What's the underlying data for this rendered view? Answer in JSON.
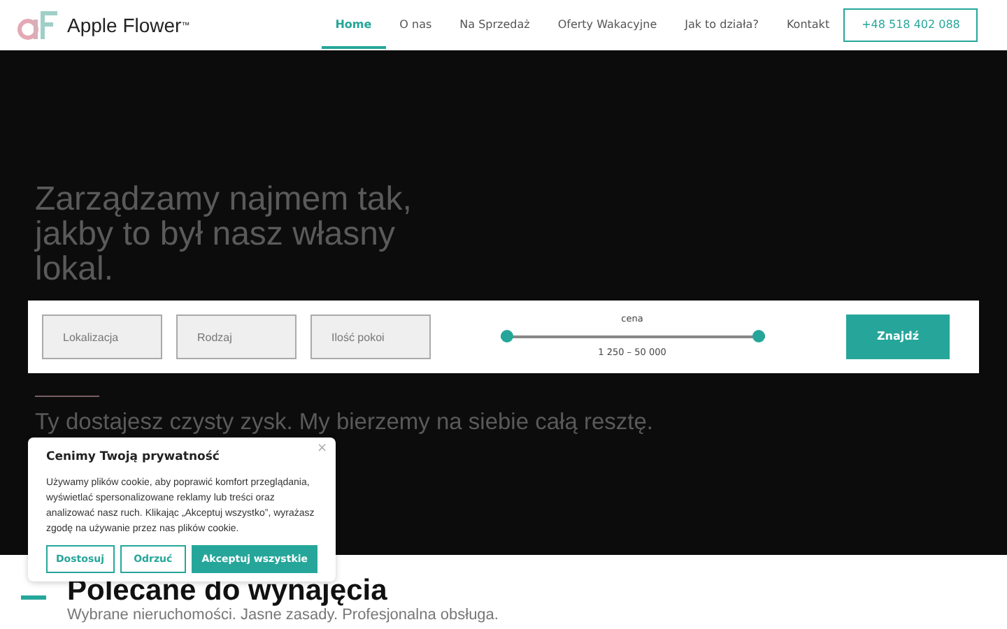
{
  "brand": {
    "name": "Apple Flower$^{™}$"
  },
  "nav": [
    {
      "label": "Home",
      "selected": true
    },
    {
      "label": "O nas",
      "selected": false
    },
    {
      "label": "Na Sprzedaż",
      "selected": false
    },
    {
      "label": "Oferty Wakacyjne",
      "selected": false
    },
    {
      "label": "Jak to działa?",
      "selected": false
    },
    {
      "label": "Kontakt",
      "selected": false
    }
  ],
  "phone_button": "+48 518 402 088",
  "hero": {
    "heading": "Zarządzamy najmem tak, jakby to był nasz własny lokal.",
    "tagline": "Ty dostajesz czysty zysk. My bierzemy na siebie całą resztę."
  },
  "search": {
    "fields": [
      {
        "placeholder": "Lokalizacja"
      },
      {
        "placeholder": "Rodzaj"
      },
      {
        "placeholder": "Ilość pokoi"
      }
    ],
    "price": {
      "label": "cena",
      "range": "1 250 – 50 000",
      "thumbs": [
        {
          "level": 0
        },
        {
          "level": 1
        }
      ]
    },
    "button": "Znajdź"
  },
  "section": {
    "heading": "Polecane do wynajęcia",
    "subheading": "Wybrane nieruchomości. Jasne zasady. Profesjonalna obsługa."
  },
  "cookie": {
    "title": "Cenimy Twoją prywatność",
    "close": "×",
    "text": "Używamy plików cookie, aby poprawić komfort przeglądania, wyświetlać spersonalizowane reklamy lub treści oraz analizować nasz ruch. Klikając „Akceptuj wszystko”, wyrażasz zgodę na używanie przez nas plików cookie.",
    "buttons": [
      {
        "label": "Dostosuj",
        "kind": "outline"
      },
      {
        "label": "Odrzuć",
        "kind": "outline"
      },
      {
        "label": "Akceptuj wszystkie",
        "kind": "solid"
      }
    ]
  }
}
